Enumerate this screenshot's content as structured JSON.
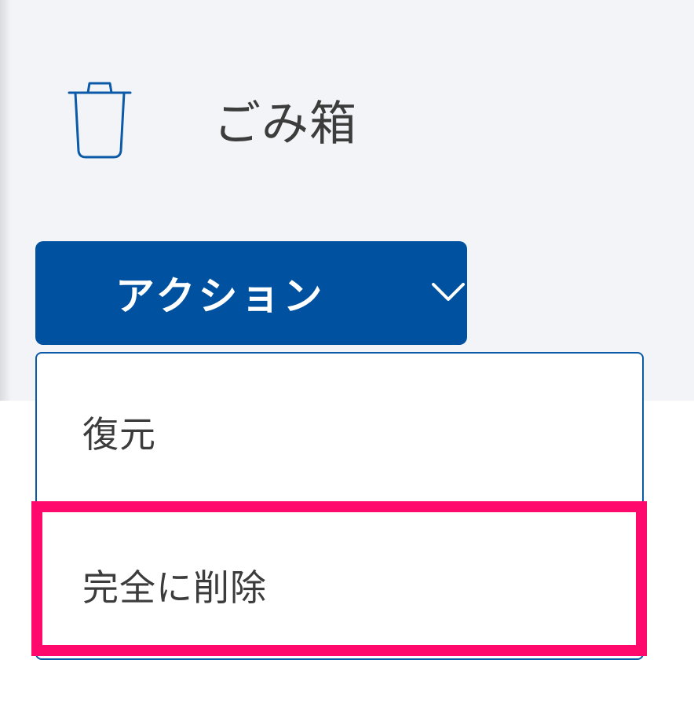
{
  "header": {
    "title": "ごみ箱",
    "icon": "trash-icon",
    "background_color": "#f3f4f7"
  },
  "action_button": {
    "label": "アクション",
    "icon": "chevron-down-icon",
    "color": "#0052a0"
  },
  "dropdown": {
    "items": [
      {
        "label": "復元"
      },
      {
        "label": "完全に削除",
        "highlighted": true
      }
    ],
    "border_color": "#0b5aa8",
    "highlight_color": "#ff0a6c"
  }
}
